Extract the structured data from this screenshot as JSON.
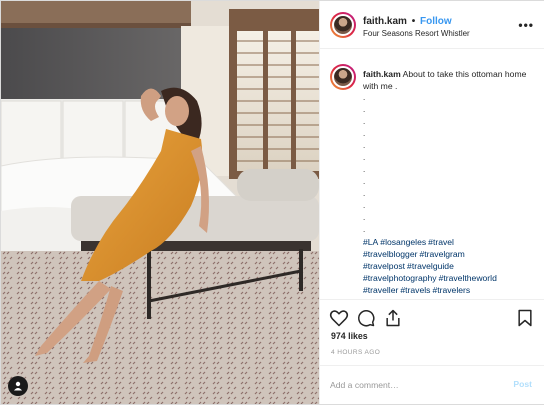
{
  "post": {
    "username": "faith.kam",
    "separator": "•",
    "follow_label": "Follow",
    "location": "Four Seasons Resort Whistler",
    "more_label": "•••"
  },
  "caption": {
    "username": "faith.kam",
    "text": "About to take this ottoman home with me .",
    "dots": [
      ".",
      ".",
      ".",
      ".",
      ".",
      ".",
      ".",
      ".",
      ".",
      ".",
      ".",
      "."
    ],
    "hashtags": [
      "#LA",
      "#losangeles",
      "#travel",
      "#travelblogger",
      "#travelgram",
      "#travelpost",
      "#travelguide",
      "#travelphotography",
      "#traveltheworld",
      "#traveller",
      "#travels",
      "#travelers"
    ]
  },
  "engagement": {
    "likes_text": "974 likes",
    "timestamp": "4 HOURS AGO"
  },
  "comment": {
    "placeholder": "Add a comment…",
    "post_label": "Post"
  },
  "icons": {
    "like": "heart-outline-icon",
    "comment": "comment-bubble-icon",
    "share": "share-upload-icon",
    "save": "bookmark-icon",
    "tagged": "user-tag-icon"
  },
  "colors": {
    "link_blue": "#3897f0",
    "hashtag": "#003569",
    "post_disabled": "#b2dffc",
    "border": "#efefef",
    "dress_orange": "#d9902e"
  }
}
